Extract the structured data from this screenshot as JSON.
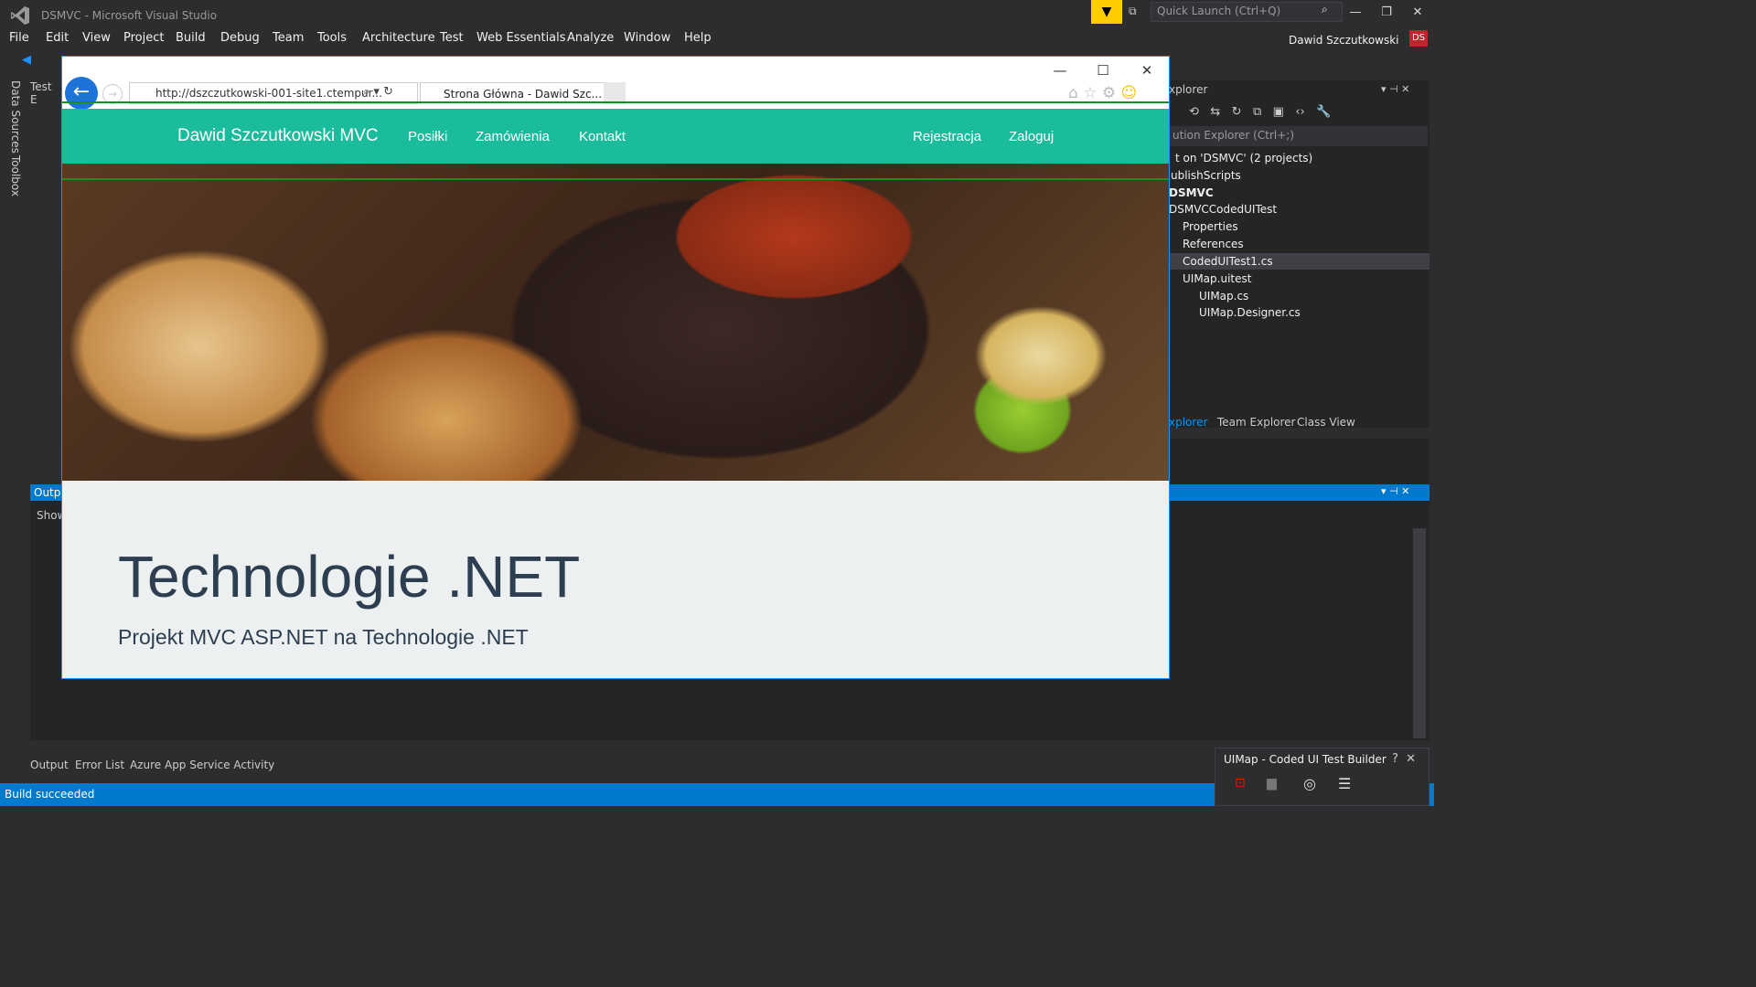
{
  "vs": {
    "title": "DSMVC - Microsoft Visual Studio",
    "quick_launch_placeholder": "Quick Launch (Ctrl+Q)",
    "user_name": "Dawid Szczutkowski",
    "user_initials": "DS",
    "menu": [
      "File",
      "Edit",
      "View",
      "Project",
      "Build",
      "Debug",
      "Team",
      "Tools",
      "Architecture",
      "Test",
      "Web Essentials",
      "Analyze",
      "Window",
      "Help"
    ],
    "side_tabs": [
      "Data Sources",
      "Toolbox"
    ],
    "test_explorer_label": "Test E",
    "output_label": "Outpu",
    "show_label": "Show",
    "solution_explorer": {
      "title": "xplorer",
      "search_placeholder": "ution Explorer (Ctrl+;)",
      "items": [
        "t on 'DSMVC' (2 projects)",
        "ublishScripts",
        "DSMVC",
        "DSMVCCodedUITest",
        "Properties",
        "References",
        "CodedUITest1.cs",
        "UIMap.uitest",
        "UIMap.cs",
        "UIMap.Designer.cs"
      ]
    },
    "sol_tabs": [
      "xplorer",
      "Team Explorer",
      "Class View"
    ],
    "bottom_tabs": [
      "Output",
      "Error List",
      "Azure App Service Activity"
    ],
    "status": "Build succeeded",
    "cuit_title": "UIMap - Coded UI Test Builder",
    "accent": "#007acc"
  },
  "browser": {
    "address": "http://dszczutkowski-001-site1.ctempur...",
    "tab_title": "Strona Główna - Dawid Szc...",
    "site": {
      "brand": "Dawid Szczutkowski MVC",
      "nav_left": [
        "Posiłki",
        "Zamówienia",
        "Kontakt"
      ],
      "nav_right": [
        "Rejestracja",
        "Zaloguj"
      ],
      "title": "Technologie .NET",
      "subtitle": "Projekt MVC ASP.NET na Technologie .NET",
      "accent": "#1abc9c"
    }
  }
}
